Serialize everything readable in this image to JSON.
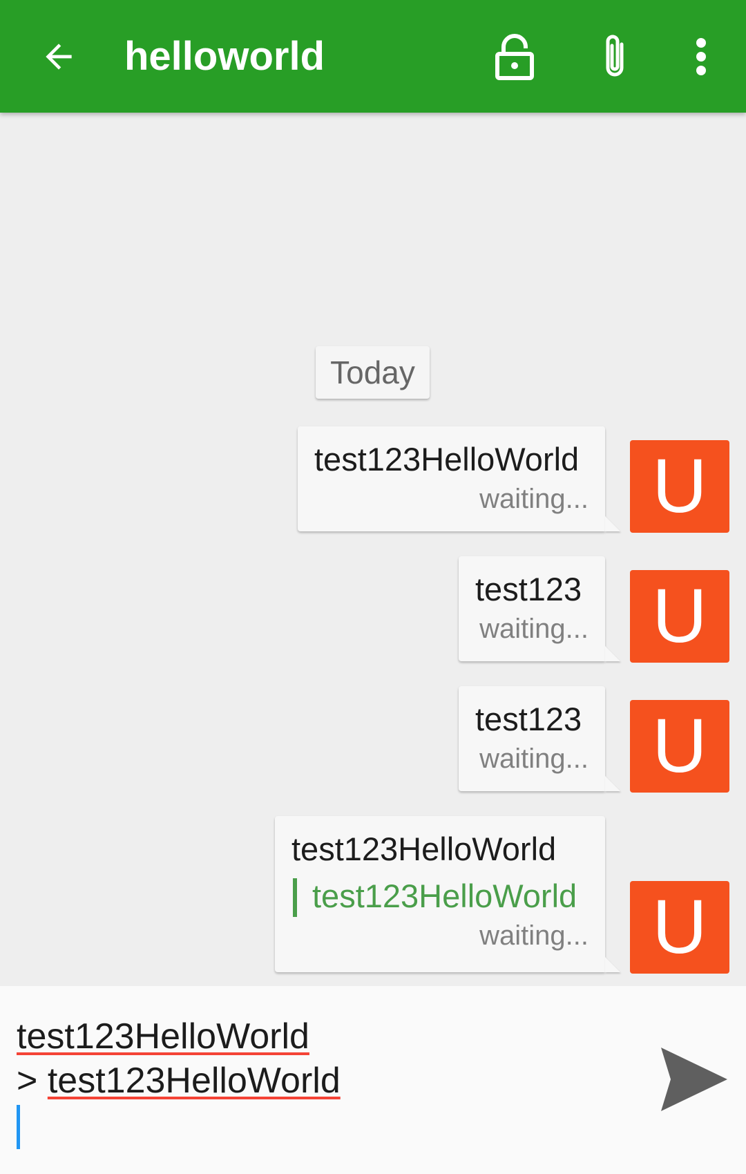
{
  "toolbar": {
    "title": "helloworld",
    "back_icon": "arrow-back-icon",
    "lock_icon": "lock-open-icon",
    "attach_icon": "paperclip-icon",
    "more_icon": "more-vert-icon",
    "color": "#289e26"
  },
  "conversation": {
    "date_label": "Today",
    "messages": [
      {
        "text": "test123HelloWorld",
        "status": "waiting...",
        "avatar": "U"
      },
      {
        "text": "test123",
        "status": "waiting...",
        "avatar": "U"
      },
      {
        "text": "test123",
        "status": "waiting...",
        "avatar": "U"
      },
      {
        "text": "test123HelloWorld",
        "quote": "test123HelloWorld",
        "status": "waiting...",
        "avatar": "U"
      }
    ],
    "avatar_color": "#f5511e",
    "quote_color": "#4a9e4a"
  },
  "composer": {
    "line1": "test123HelloWorld",
    "line2_prefix": "> ",
    "line2_text": "test123HelloWorld",
    "send_icon": "send-icon"
  }
}
